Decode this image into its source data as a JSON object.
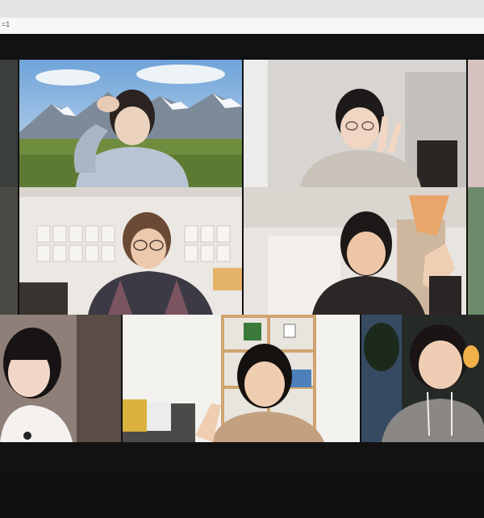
{
  "browser": {
    "url_fragment": "=1"
  },
  "meeting": {
    "view": "gallery",
    "participants_visible": 11,
    "active_speaker_color": "#2fb24a"
  },
  "icons": [
    "peace-sign-gesture",
    "wave-gesture",
    "salute-gesture"
  ]
}
